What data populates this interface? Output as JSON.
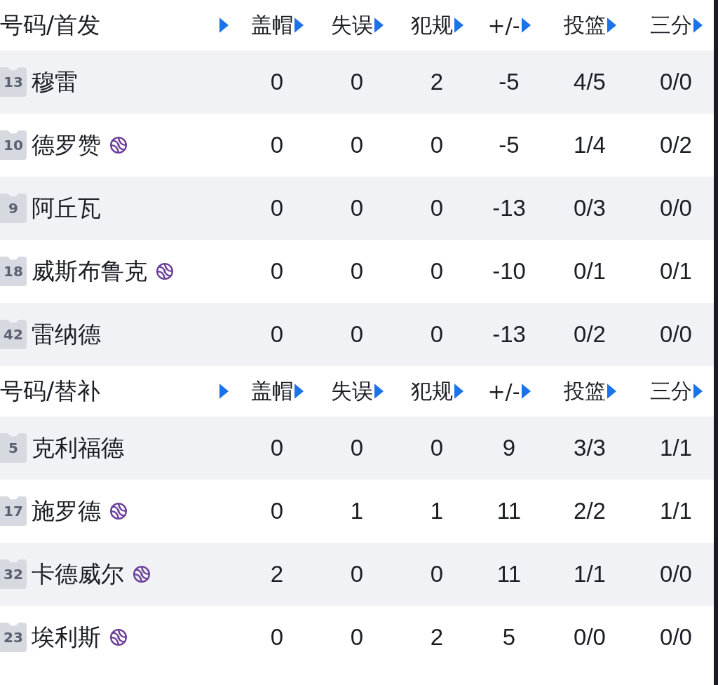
{
  "sections": [
    {
      "header": {
        "title": "号码/首发",
        "cut_column_arrow": true,
        "columns": [
          "盖帽",
          "失误",
          "犯规",
          "+/-",
          "投篮",
          "三分"
        ]
      },
      "rows": [
        {
          "number": "13",
          "name": "穆雷",
          "ball_icon": false,
          "stats": [
            "0",
            "0",
            "2",
            "-5",
            "4/5",
            "0/0"
          ]
        },
        {
          "number": "10",
          "name": "德罗赞",
          "ball_icon": true,
          "stats": [
            "0",
            "0",
            "0",
            "-5",
            "1/4",
            "0/2"
          ]
        },
        {
          "number": "9",
          "name": "阿丘瓦",
          "ball_icon": false,
          "stats": [
            "0",
            "0",
            "0",
            "-13",
            "0/3",
            "0/0"
          ]
        },
        {
          "number": "18",
          "name": "威斯布鲁克",
          "ball_icon": true,
          "stats": [
            "0",
            "0",
            "0",
            "-10",
            "0/1",
            "0/1"
          ]
        },
        {
          "number": "42",
          "name": "雷纳德",
          "ball_icon": false,
          "stats": [
            "0",
            "0",
            "0",
            "-13",
            "0/2",
            "0/0"
          ]
        }
      ]
    },
    {
      "header": {
        "title": "号码/替补",
        "cut_column_arrow": true,
        "columns": [
          "盖帽",
          "失误",
          "犯规",
          "+/-",
          "投篮",
          "三分"
        ]
      },
      "rows": [
        {
          "number": "5",
          "name": "克利福德",
          "ball_icon": false,
          "stats": [
            "0",
            "0",
            "0",
            "9",
            "3/3",
            "1/1"
          ]
        },
        {
          "number": "17",
          "name": "施罗德",
          "ball_icon": true,
          "stats": [
            "0",
            "1",
            "1",
            "11",
            "2/2",
            "1/1"
          ]
        },
        {
          "number": "32",
          "name": "卡德威尔",
          "ball_icon": true,
          "stats": [
            "2",
            "0",
            "0",
            "11",
            "1/1",
            "0/0"
          ]
        },
        {
          "number": "23",
          "name": "埃利斯",
          "ball_icon": true,
          "stats": [
            "0",
            "0",
            "2",
            "5",
            "0/0",
            "0/0"
          ]
        }
      ]
    }
  ]
}
